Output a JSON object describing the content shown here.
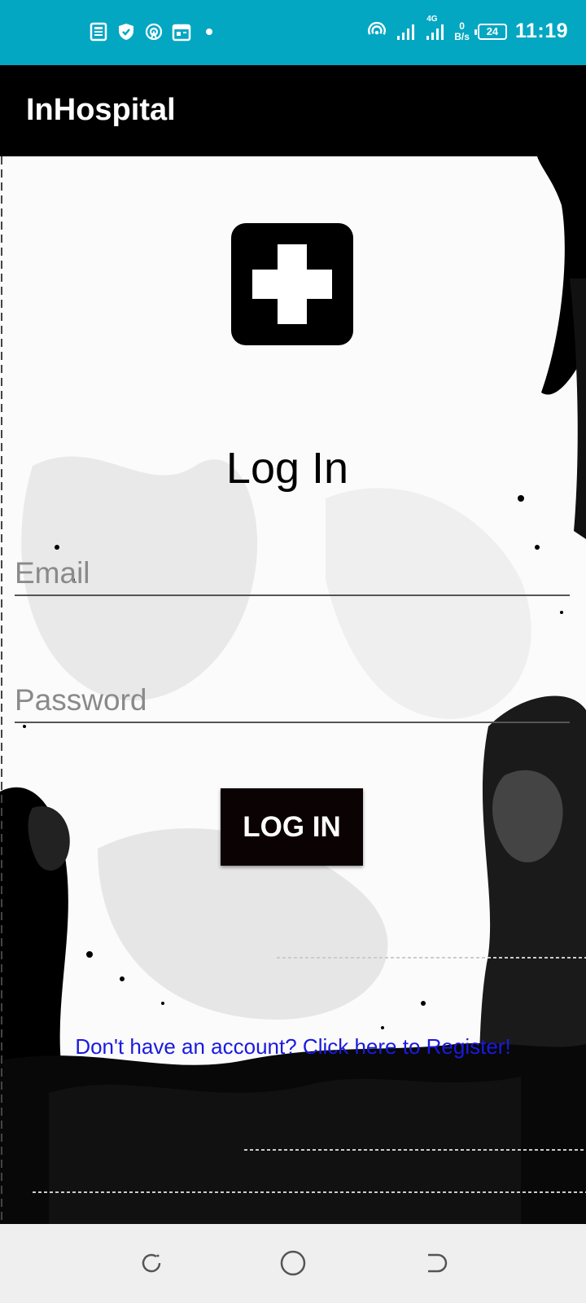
{
  "status_bar": {
    "time": "11:19",
    "net_speed_value": "0",
    "net_speed_unit": "B/s",
    "battery": "24",
    "network_type": "4G",
    "background_color": "#03a7c2",
    "left_icons": [
      "news-icon",
      "shield-icon",
      "hotspot-icon",
      "calendar-icon",
      "dot-icon"
    ],
    "right_icons": [
      "hotspot-icon",
      "signal-icon",
      "signal-4g-icon",
      "battery-icon"
    ]
  },
  "app_bar": {
    "title": "InHospital",
    "background_color": "#000000"
  },
  "login": {
    "logo_icon": "medical-cross-icon",
    "heading": "Log In",
    "email_placeholder": "Email",
    "email_value": "",
    "password_placeholder": "Password",
    "password_value": "",
    "button_label": "LOG IN",
    "register_link": "Don't have an account? Click here to Register!",
    "link_color": "#1a1ae0"
  },
  "nav_bar": {
    "icons": [
      "recent-apps-icon",
      "home-icon",
      "back-icon"
    ]
  }
}
